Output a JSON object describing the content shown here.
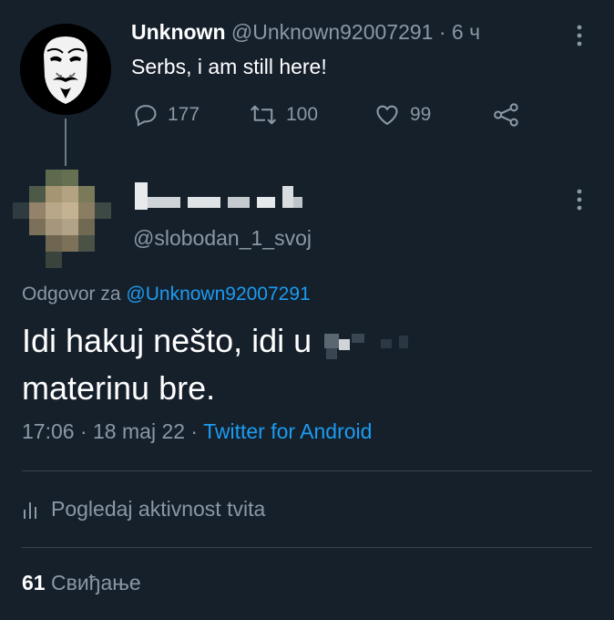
{
  "parent": {
    "name": "Unknown",
    "handle": "@Unknown92007291",
    "time_sep": "·",
    "time": "6 ч",
    "text": "Serbs, i am still here!",
    "replies": "177",
    "retweets": "100",
    "likes": "99"
  },
  "reply": {
    "handle": "@slobodan_1_svoj",
    "replying_prefix": "Odgovor za",
    "replying_to": "@Unknown92007291",
    "text_line1": "Idi hakuj nešto, idi u",
    "text_line2": "materinu bre.",
    "time": "17:06",
    "sep1": "·",
    "date": "18 maj 22",
    "sep2": "·",
    "client": "Twitter for Android"
  },
  "activity_label": "Pogledaj aktivnost tvita",
  "likes_count": "61",
  "likes_label": "Свиђање",
  "colors": {
    "background": "#15202b",
    "muted": "#8b98a5",
    "accent": "#1d9bf0",
    "divider": "#38444d"
  }
}
